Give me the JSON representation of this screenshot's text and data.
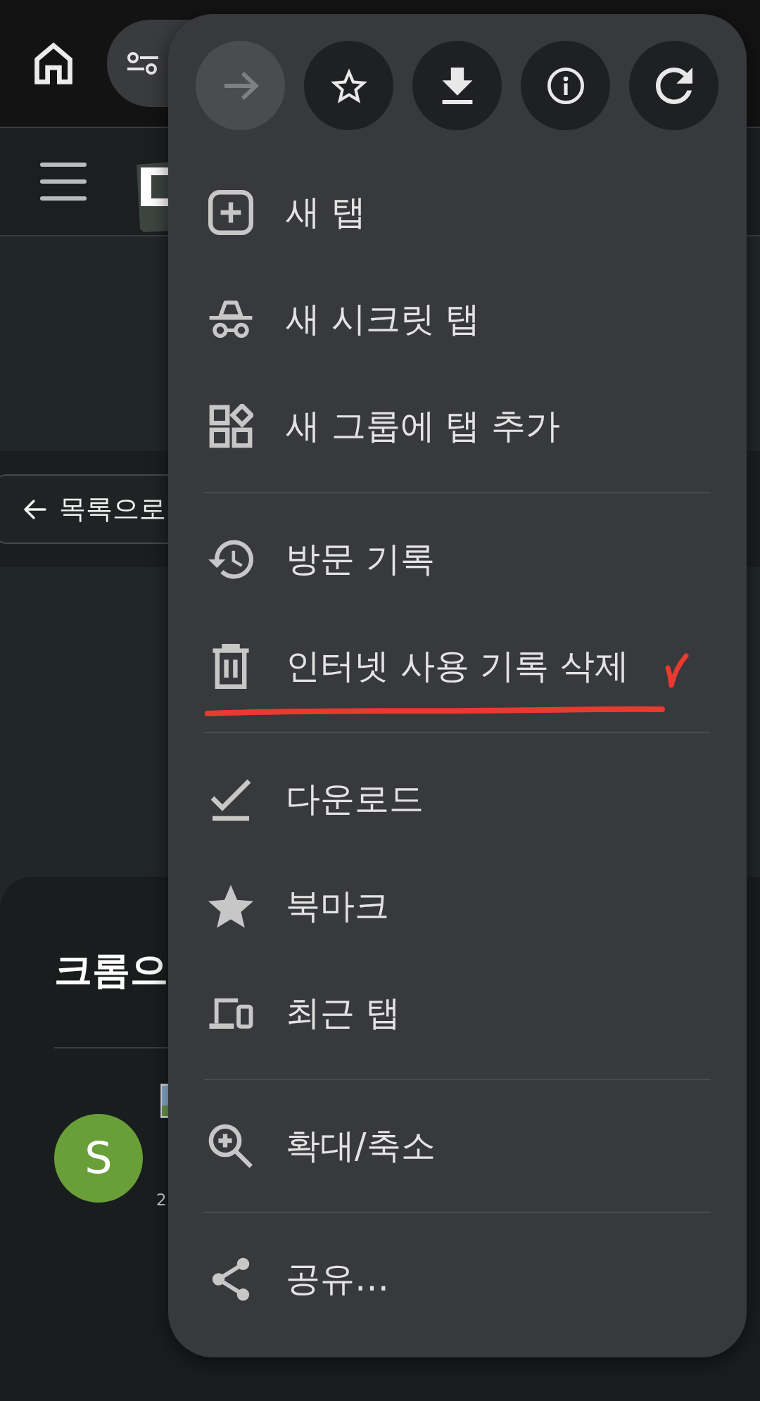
{
  "page": {
    "back_button": {
      "label": "목록으로"
    },
    "post": {
      "title": "크롬으",
      "avatar_letter": "S",
      "meta": "2"
    }
  },
  "menu": {
    "actions": [
      {
        "disabled": true
      },
      {
        "disabled": false
      },
      {
        "disabled": false
      },
      {
        "disabled": false
      },
      {
        "disabled": false
      }
    ],
    "sections": [
      {
        "items": [
          {
            "label": "새 탭",
            "marked": false
          },
          {
            "label": "새 시크릿 탭",
            "marked": false
          },
          {
            "label": "새 그룹에 탭 추가",
            "marked": false
          }
        ]
      },
      {
        "items": [
          {
            "label": "방문 기록",
            "marked": false
          },
          {
            "label": "인터넷 사용 기록 삭제",
            "marked": true
          }
        ]
      },
      {
        "items": [
          {
            "label": "다운로드",
            "marked": false
          },
          {
            "label": "북마크",
            "marked": false
          },
          {
            "label": "최근 탭",
            "marked": false
          }
        ]
      },
      {
        "items": [
          {
            "label": "확대/축소",
            "marked": false
          }
        ]
      },
      {
        "items": [
          {
            "label": "공유…",
            "marked": false
          }
        ]
      }
    ]
  }
}
